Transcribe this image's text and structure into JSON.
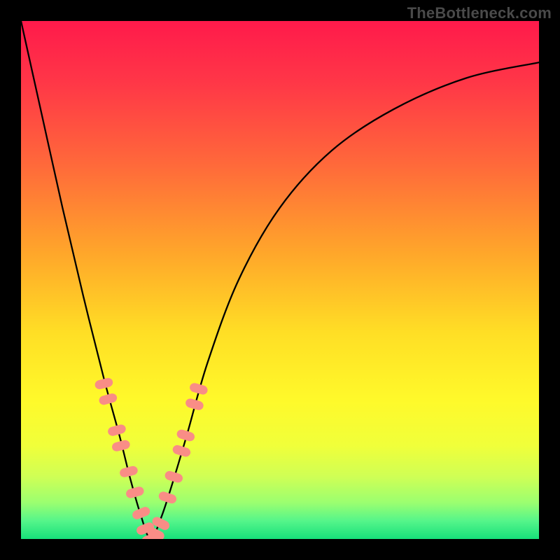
{
  "watermark": "TheBottleneck.com",
  "chart_data": {
    "type": "line",
    "title": "",
    "xlabel": "",
    "ylabel": "",
    "xlim": [
      0,
      100
    ],
    "ylim": [
      0,
      100
    ],
    "grid": false,
    "legend": false,
    "notes": "Rainbow vertical gradient background (red top → green bottom). Black V-shaped bottleneck curve with coral/pink dash markers on the lower portions of each arm. Minimum of the curve is near x≈25, y≈0.",
    "gradient_stops": [
      {
        "offset": 0.0,
        "color": "#ff1a4b"
      },
      {
        "offset": 0.12,
        "color": "#ff3747"
      },
      {
        "offset": 0.28,
        "color": "#ff6a3a"
      },
      {
        "offset": 0.45,
        "color": "#ffa72a"
      },
      {
        "offset": 0.6,
        "color": "#ffde25"
      },
      {
        "offset": 0.73,
        "color": "#fff92a"
      },
      {
        "offset": 0.82,
        "color": "#f0ff3a"
      },
      {
        "offset": 0.88,
        "color": "#cfff55"
      },
      {
        "offset": 0.93,
        "color": "#9bff70"
      },
      {
        "offset": 0.965,
        "color": "#55f58a"
      },
      {
        "offset": 1.0,
        "color": "#17e07a"
      }
    ],
    "series": [
      {
        "name": "bottleneck-curve",
        "color": "#000000",
        "x": [
          0,
          4,
          8,
          12,
          16,
          19,
          21,
          23,
          25,
          27,
          29,
          32,
          36,
          42,
          50,
          60,
          72,
          86,
          100
        ],
        "y": [
          100,
          82,
          64,
          47,
          31,
          20,
          12,
          5,
          0,
          4,
          10,
          20,
          34,
          50,
          64,
          75,
          83,
          89,
          92
        ]
      }
    ],
    "markers": {
      "name": "pink-dash-markers",
      "color": "#f98d86",
      "left_arm_y_range": [
        5,
        30
      ],
      "right_arm_y_range": [
        3,
        30
      ],
      "bottom_cluster_y_range": [
        0,
        4
      ],
      "points": [
        {
          "x": 16.0,
          "y": 30
        },
        {
          "x": 16.8,
          "y": 27
        },
        {
          "x": 18.5,
          "y": 21
        },
        {
          "x": 19.3,
          "y": 18
        },
        {
          "x": 20.8,
          "y": 13
        },
        {
          "x": 22.0,
          "y": 9
        },
        {
          "x": 23.2,
          "y": 5
        },
        {
          "x": 24.0,
          "y": 2
        },
        {
          "x": 25.0,
          "y": 0
        },
        {
          "x": 26.0,
          "y": 1
        },
        {
          "x": 27.0,
          "y": 3
        },
        {
          "x": 28.3,
          "y": 8
        },
        {
          "x": 29.5,
          "y": 12
        },
        {
          "x": 31.0,
          "y": 17
        },
        {
          "x": 31.8,
          "y": 20
        },
        {
          "x": 33.5,
          "y": 26
        },
        {
          "x": 34.3,
          "y": 29
        }
      ]
    }
  }
}
